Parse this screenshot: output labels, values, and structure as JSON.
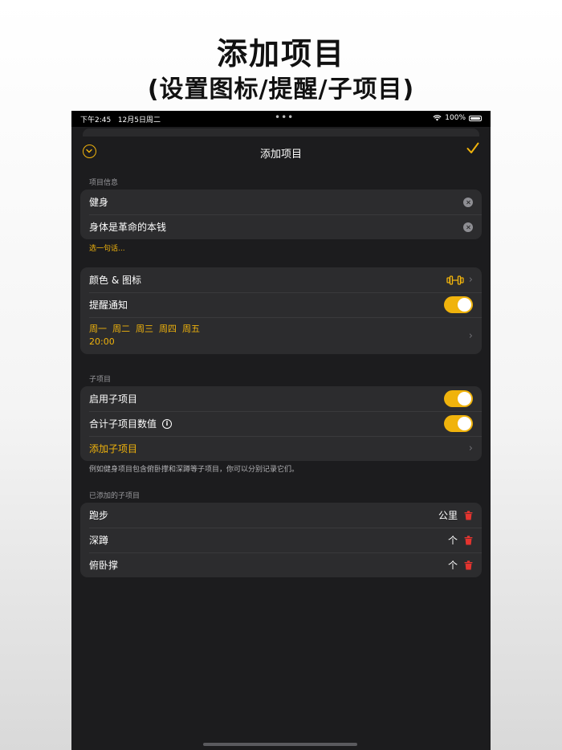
{
  "hero": {
    "title": "添加项目",
    "subtitle": "(设置图标/提醒/子项目)"
  },
  "status_bar": {
    "time": "下午2:45",
    "date": "12月5日周二",
    "dots": "•••",
    "battery": "100%"
  },
  "nav": {
    "title": "添加项目",
    "left_icon": "chevron-down-circle-icon",
    "right_icon": "checkmark-icon"
  },
  "project_info": {
    "section_label": "项目信息",
    "name_value": "健身",
    "motto_value": "身体是革命的本钱",
    "pick_phrase": "选一句话..."
  },
  "settings": {
    "color_icon_label": "颜色 & 图标",
    "reminder_label": "提醒通知",
    "reminder_on": true,
    "reminder_days": "周一  周二  周三  周四  周五",
    "reminder_time": "20:00"
  },
  "subitems": {
    "section_label": "子项目",
    "enable_label": "启用子项目",
    "enable_on": true,
    "sum_label": "合计子项目数值",
    "sum_on": true,
    "add_label": "添加子项目",
    "footnote": "例如健身项目包含俯卧撑和深蹲等子项目，你可以分别记录它们。"
  },
  "added": {
    "section_label": "已添加的子项目",
    "items": [
      {
        "name": "跑步",
        "unit": "公里"
      },
      {
        "name": "深蹲",
        "unit": "个"
      },
      {
        "name": "俯卧撑",
        "unit": "个"
      }
    ]
  },
  "colors": {
    "accent": "#f0b30c",
    "delete": "#e5342f",
    "background": "#1c1c1e",
    "cell": "#2c2c2e"
  }
}
